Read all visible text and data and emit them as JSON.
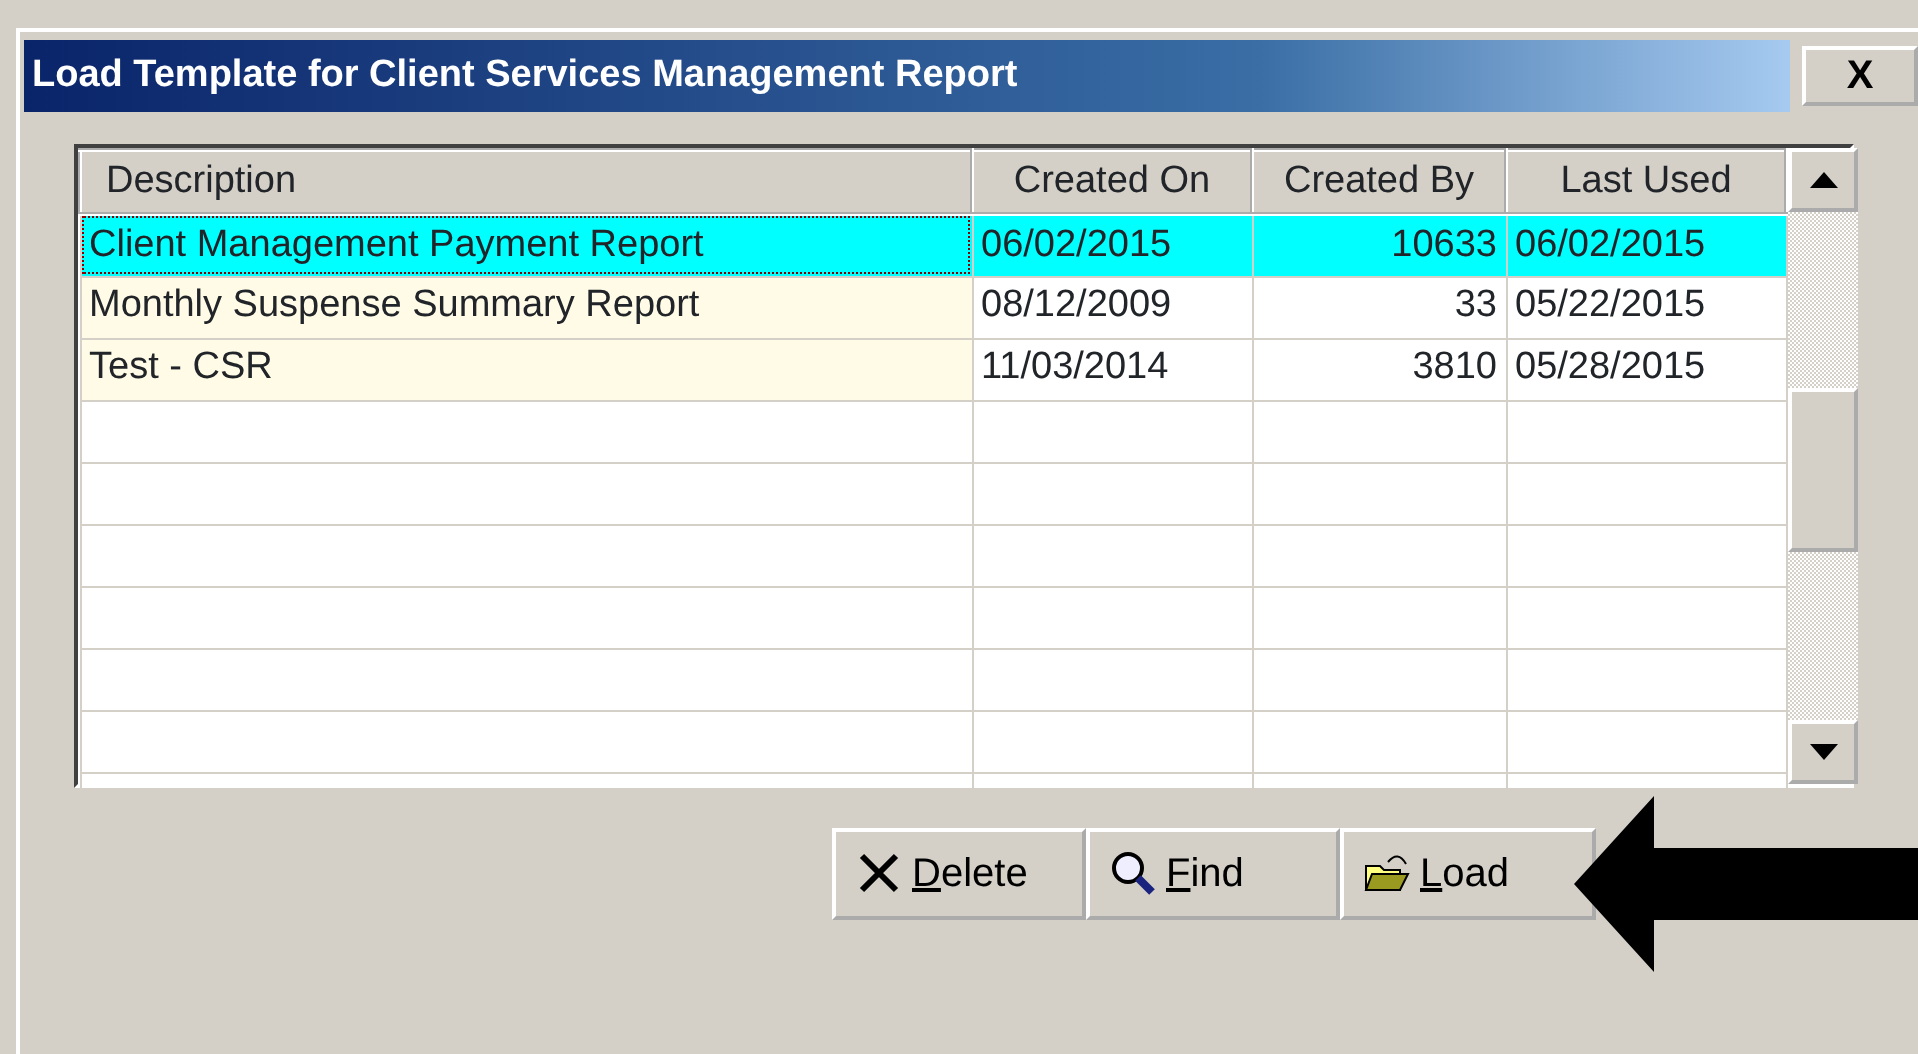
{
  "window": {
    "title": "Load Template for Client Services Management Report",
    "close": "X"
  },
  "table": {
    "columns": [
      "Description",
      "Created On",
      "Created By",
      "Last Used"
    ],
    "rows": [
      {
        "cells": [
          "Client Management Payment Report",
          "06/02/2015",
          "10633",
          "06/02/2015"
        ],
        "selected": true
      },
      {
        "cells": [
          "Monthly Suspense Summary Report",
          "08/12/2009",
          "33",
          "05/22/2015"
        ],
        "selected": false
      },
      {
        "cells": [
          "Test - CSR",
          "11/03/2014",
          "3810",
          "05/28/2015"
        ],
        "selected": false
      }
    ]
  },
  "buttons": [
    {
      "kind": "delete",
      "label": "Delete"
    },
    {
      "kind": "find",
      "label": "Find"
    },
    {
      "kind": "load",
      "label": "Load"
    }
  ]
}
